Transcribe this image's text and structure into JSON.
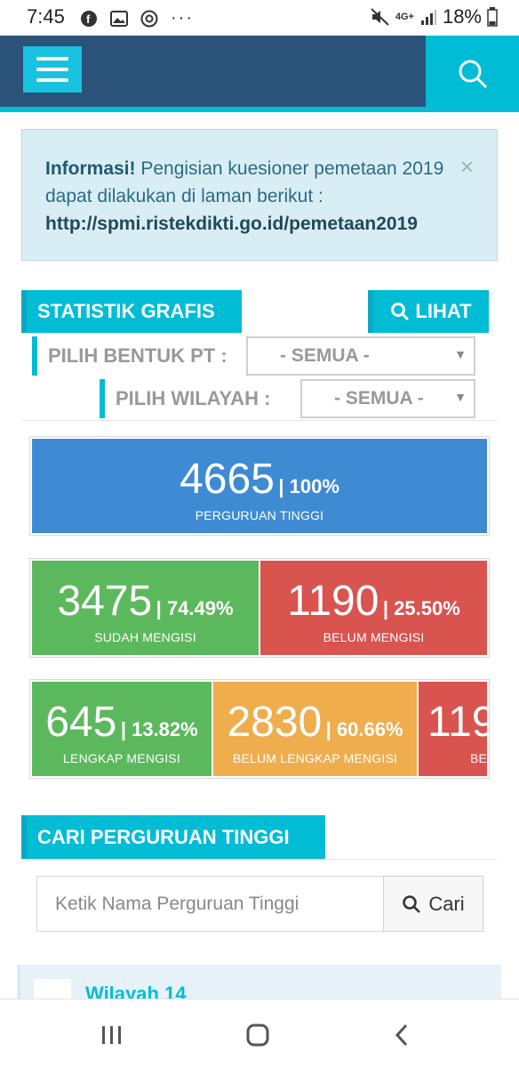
{
  "status_bar": {
    "time": "7:45",
    "battery": "18%",
    "network": "4G+"
  },
  "alert": {
    "strong": "Informasi!",
    "message": " Pengisian kuesioner pemetaan 2019 dapat dilakukan di laman berikut : ",
    "link": "http://spmi.ristekdikti.go.id/pemetaan2019",
    "close": "×"
  },
  "statistik": {
    "title": "STATISTIK GRAFIS",
    "lihat_label": "LIHAT",
    "bentuk_label": "PILIH BENTUK PT :",
    "bentuk_value": "- SEMUA -",
    "wilayah_label": "PILIH WILAYAH :",
    "wilayah_value": "- SEMUA -"
  },
  "stats": {
    "total": {
      "num": "4665",
      "pct": "| 100%",
      "label": "PERGURUAN TINGGI"
    },
    "sudah": {
      "num": "3475",
      "pct": "| 74.49%",
      "label": "SUDAH MENGISI"
    },
    "belum": {
      "num": "1190",
      "pct": "| 25.50%",
      "label": "BELUM MENGISI"
    },
    "lengkap": {
      "num": "645",
      "pct": "| 13.82%",
      "label": "LENGKAP MENGISI"
    },
    "belum_lengkap": {
      "num": "2830",
      "pct": "| 60.66%",
      "label": "BELUM LENGKAP MENGISI"
    },
    "cut": {
      "num": "119",
      "label": "BE"
    }
  },
  "cari": {
    "title": "CARI PERGURUAN TINGGI",
    "placeholder": "Ketik Nama Perguruan Tinggi",
    "button": "Cari"
  },
  "wilayah_card": {
    "title": "Wilayah 14"
  },
  "colors": {
    "header": "#2b5279",
    "accent": "#00bcd4",
    "blue": "#3e8bd4",
    "green": "#5cb85c",
    "red": "#d9534f",
    "orange": "#efad4e"
  }
}
